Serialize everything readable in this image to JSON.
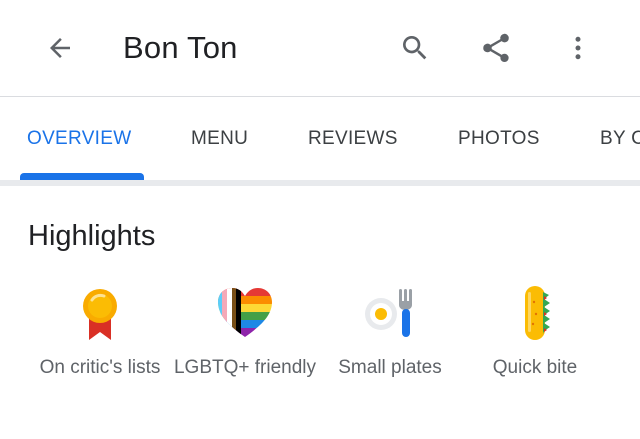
{
  "appbar": {
    "title": "Bon Ton",
    "back_icon": "arrow-left-icon",
    "actions": [
      "search-icon",
      "share-icon",
      "more-vert-icon"
    ]
  },
  "tabs": [
    {
      "label": "OVERVIEW",
      "active": true
    },
    {
      "label": "MENU",
      "active": false
    },
    {
      "label": "REVIEWS",
      "active": false
    },
    {
      "label": "PHOTOS",
      "active": false
    },
    {
      "label": "BY C",
      "active": false
    }
  ],
  "colors": {
    "accent": "#1a73e8",
    "text_primary": "#202124",
    "text_secondary": "#5f6368",
    "icon_gray": "#5f6368"
  },
  "highlights": {
    "title": "Highlights",
    "items": [
      {
        "label": "On critic's lists",
        "icon": "award-ribbon-icon"
      },
      {
        "label": "LGBTQ+ friendly",
        "icon": "pride-heart-icon"
      },
      {
        "label": "Small plates",
        "icon": "egg-fork-icon"
      },
      {
        "label": "Quick bite",
        "icon": "sandwich-icon"
      }
    ]
  }
}
